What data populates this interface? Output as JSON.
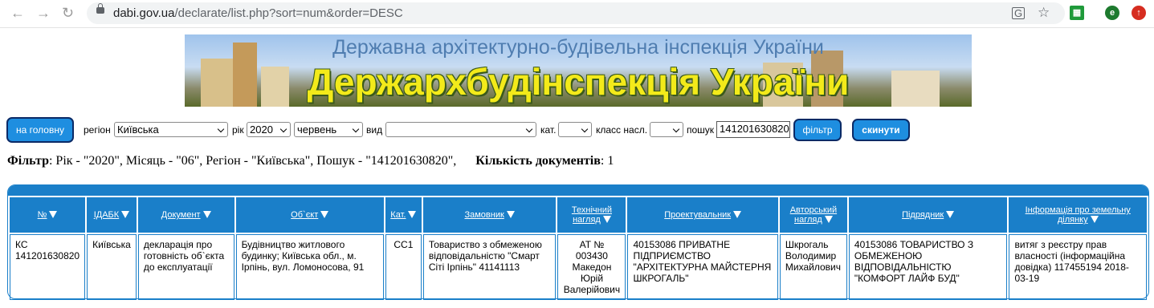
{
  "browser": {
    "url_host": "dabi.gov.ua",
    "url_path": "/declarate/list.php?sort=num&order=DESC",
    "profile_initial": "e"
  },
  "banner": {
    "subtitle": "Державна архітектурно-будівельна інспекція України",
    "title": "Держархбудінспекція України"
  },
  "filters": {
    "home_button": "на головну",
    "region_label": "регіон",
    "region_value": "Київська",
    "year_label": "рік",
    "year_value": "2020",
    "month_value": "червень",
    "type_label": "вид",
    "type_value": "",
    "category_label": "кат.",
    "category_value": "",
    "class_label": "класс насл.",
    "class_value": "",
    "search_label": "пошук",
    "search_value": "141201630820",
    "filter_button": "фільтр",
    "reset_button": "скинути"
  },
  "summary": {
    "filter_label": "Фільтр",
    "filter_text": ": Рік - \"2020\", Місяць - \"06\", Регіон - \"Київська\", Пошук - \"141201630820\",",
    "count_label": "Кількість документів",
    "count_text": ": 1"
  },
  "table": {
    "headers": [
      "№",
      "ІДАБК",
      "Документ",
      "Об`єкт",
      "Кат.",
      "Замовник",
      "Технічний нагляд",
      "Проектувальник",
      "Авторський нагляд",
      "Підрядник",
      "Інформація про земельну ділянку"
    ],
    "rows": [
      {
        "num": "КС 141201630820",
        "idabk": "Київська",
        "document": "декларація про готовність об`єкта до експлуатації",
        "object": "Будівництво житлового будинку; Київська обл., м. Ірпінь, вул. Ломоносова, 91",
        "category": "СС1",
        "customer": "Товариство з обмеженою відповідальністю \"Смарт Сіті Ірпінь\" 41141113",
        "tech_supervision": "АТ № 003430 Македон Юрій Валерійович",
        "designer": "40153086 ПРИВАТНЕ ПІДПРИЄМСТВО \"АРХІТЕКТУРНА МАЙСТЕРНЯ ШКРОГАЛЬ\"",
        "author_supervision": "Шкрогаль Володимир Михайлович",
        "contractor": "40153086 ТОВАРИСТВО З ОБМЕЖЕНОЮ ВІДПОВІДАЛЬНІСТЮ \"КОМФОРТ ЛАЙФ БУД\"",
        "land_info": "витяг з реєстру прав власності (інформаційна довідка) 117455194 2018-03-19"
      }
    ]
  }
}
